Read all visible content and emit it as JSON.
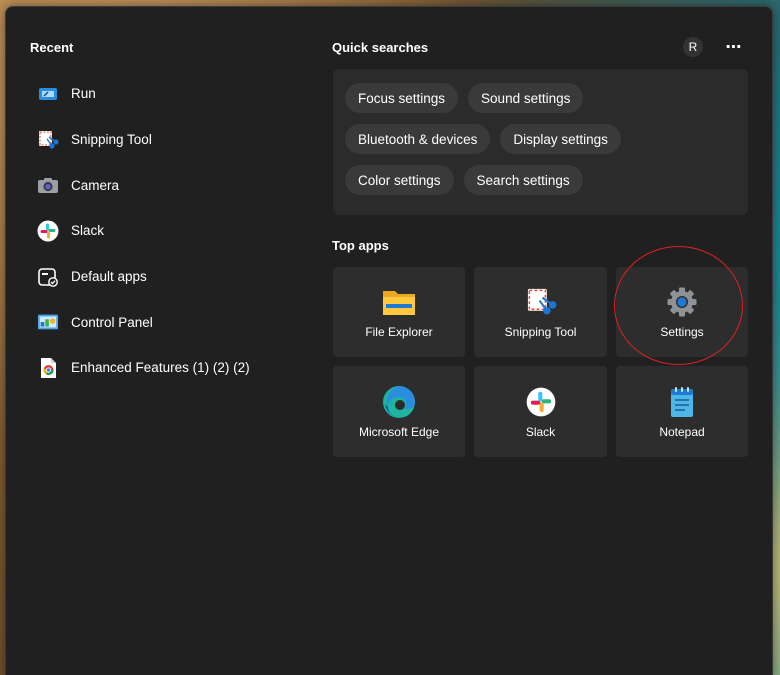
{
  "recent": {
    "heading": "Recent",
    "items": [
      {
        "label": "Run",
        "icon": "run-icon"
      },
      {
        "label": "Snipping Tool",
        "icon": "snipping-tool-icon"
      },
      {
        "label": "Camera",
        "icon": "camera-icon"
      },
      {
        "label": "Slack",
        "icon": "slack-icon"
      },
      {
        "label": "Default apps",
        "icon": "default-apps-icon"
      },
      {
        "label": "Control Panel",
        "icon": "control-panel-icon"
      },
      {
        "label": "Enhanced Features (1) (2) (2)",
        "icon": "chrome-file-icon"
      }
    ]
  },
  "header": {
    "avatar_initial": "R",
    "more_label": "⋯"
  },
  "quick_searches": {
    "heading": "Quick searches",
    "rows": [
      [
        "Focus settings",
        "Sound settings"
      ],
      [
        "Bluetooth & devices",
        "Display settings"
      ],
      [
        "Color settings",
        "Search settings"
      ]
    ]
  },
  "top_apps": {
    "heading": "Top apps",
    "items": [
      {
        "label": "File Explorer",
        "icon": "folder-icon"
      },
      {
        "label": "Snipping Tool",
        "icon": "snipping-tool-icon"
      },
      {
        "label": "Settings",
        "icon": "gear-icon"
      },
      {
        "label": "Microsoft Edge",
        "icon": "edge-icon"
      },
      {
        "label": "Slack",
        "icon": "slack-icon"
      },
      {
        "label": "Notepad",
        "icon": "notepad-icon"
      }
    ]
  },
  "colors": {
    "panel_bg": "#202020",
    "tile_bg": "#2d2d2d",
    "chip_bg": "#3a3a3a",
    "highlight": "#e02020"
  }
}
